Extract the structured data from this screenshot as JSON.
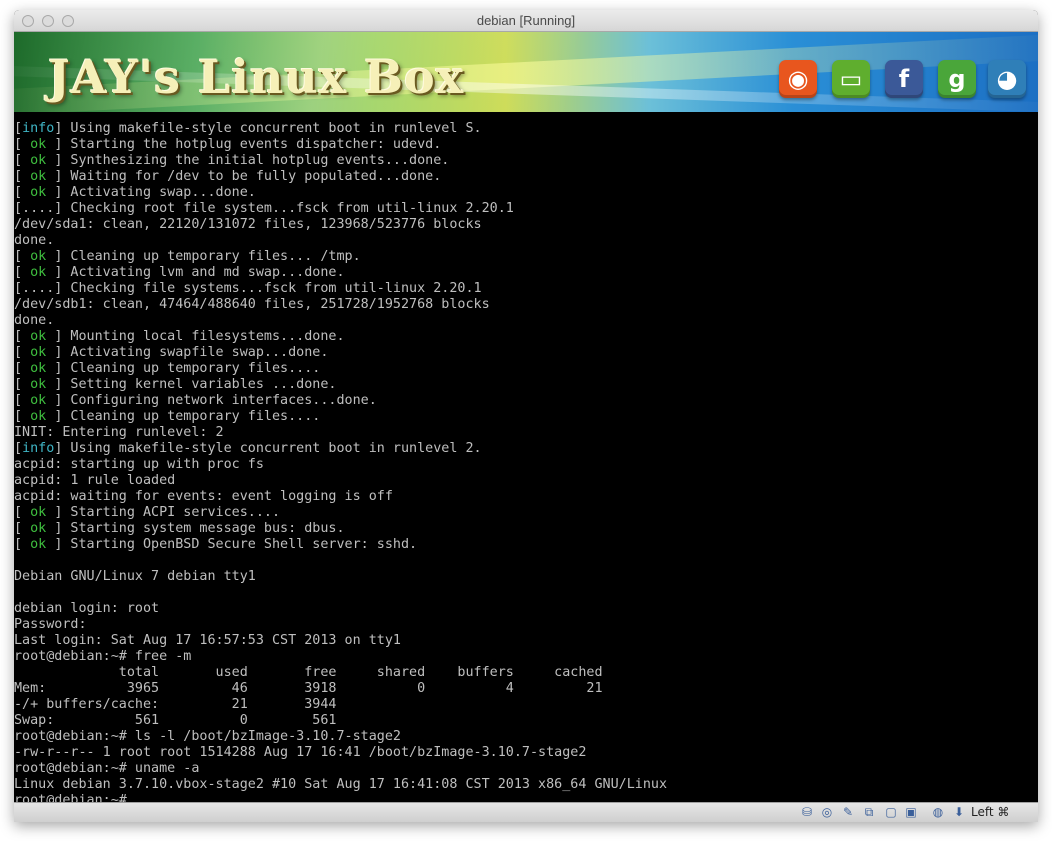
{
  "window": {
    "title": "debian [Running]"
  },
  "banner": {
    "brand": "JAY's Linux Box",
    "icons": [
      {
        "name": "rss-icon",
        "glyph": "◉",
        "color": "#e8561e"
      },
      {
        "name": "chat-icon",
        "glyph": "▭",
        "color": "#5fae2e"
      },
      {
        "name": "facebook-icon",
        "glyph": "f",
        "color": "#3b5998"
      },
      {
        "name": "google-icon",
        "glyph": "g",
        "color": "#4aa63a"
      },
      {
        "name": "penguin-icon",
        "glyph": "◕",
        "color": "#2f7fb8"
      }
    ]
  },
  "terminal": {
    "lines": [
      {
        "tag": "info",
        "text": " Using makefile-style concurrent boot in runlevel S."
      },
      {
        "tag": "ok",
        "text": " Starting the hotplug events dispatcher: udevd."
      },
      {
        "tag": "ok",
        "text": " Synthesizing the initial hotplug events...done."
      },
      {
        "tag": "ok",
        "text": " Waiting for /dev to be fully populated...done."
      },
      {
        "tag": "ok",
        "text": " Activating swap...done."
      },
      {
        "tag": "",
        "text": "[....] Checking root file system...fsck from util-linux 2.20.1"
      },
      {
        "tag": "",
        "text": "/dev/sda1: clean, 22120/131072 files, 123968/523776 blocks"
      },
      {
        "tag": "",
        "text": "done."
      },
      {
        "tag": "ok",
        "text": " Cleaning up temporary files... /tmp."
      },
      {
        "tag": "ok",
        "text": " Activating lvm and md swap...done."
      },
      {
        "tag": "",
        "text": "[....] Checking file systems...fsck from util-linux 2.20.1"
      },
      {
        "tag": "",
        "text": "/dev/sdb1: clean, 47464/488640 files, 251728/1952768 blocks"
      },
      {
        "tag": "",
        "text": "done."
      },
      {
        "tag": "ok",
        "text": " Mounting local filesystems...done."
      },
      {
        "tag": "ok",
        "text": " Activating swapfile swap...done."
      },
      {
        "tag": "ok",
        "text": " Cleaning up temporary files...."
      },
      {
        "tag": "ok",
        "text": " Setting kernel variables ...done."
      },
      {
        "tag": "ok",
        "text": " Configuring network interfaces...done."
      },
      {
        "tag": "ok",
        "text": " Cleaning up temporary files...."
      },
      {
        "tag": "",
        "text": "INIT: Entering runlevel: 2"
      },
      {
        "tag": "info",
        "text": " Using makefile-style concurrent boot in runlevel 2."
      },
      {
        "tag": "",
        "text": "acpid: starting up with proc fs"
      },
      {
        "tag": "",
        "text": "acpid: 1 rule loaded"
      },
      {
        "tag": "",
        "text": "acpid: waiting for events: event logging is off"
      },
      {
        "tag": "ok",
        "text": " Starting ACPI services...."
      },
      {
        "tag": "ok",
        "text": " Starting system message bus: dbus."
      },
      {
        "tag": "ok",
        "text": " Starting OpenBSD Secure Shell server: sshd."
      },
      {
        "tag": "",
        "text": ""
      },
      {
        "tag": "",
        "text": "Debian GNU/Linux 7 debian tty1"
      },
      {
        "tag": "",
        "text": ""
      },
      {
        "tag": "",
        "text": "debian login: root"
      },
      {
        "tag": "",
        "text": "Password:"
      },
      {
        "tag": "",
        "text": "Last login: Sat Aug 17 16:57:53 CST 2013 on tty1"
      },
      {
        "tag": "",
        "text": "root@debian:~# free -m"
      },
      {
        "tag": "",
        "text": "             total       used       free     shared    buffers     cached"
      },
      {
        "tag": "",
        "text": "Mem:          3965         46       3918          0          4         21"
      },
      {
        "tag": "",
        "text": "-/+ buffers/cache:         21       3944"
      },
      {
        "tag": "",
        "text": "Swap:          561          0        561"
      },
      {
        "tag": "",
        "text": "root@debian:~# ls -l /boot/bzImage-3.10.7-stage2"
      },
      {
        "tag": "",
        "text": "-rw-r--r-- 1 root root 1514288 Aug 17 16:41 /boot/bzImage-3.10.7-stage2"
      },
      {
        "tag": "",
        "text": "root@debian:~# uname -a"
      },
      {
        "tag": "",
        "text": "Linux debian 3.7.10.vbox-stage2 #10 Sat Aug 17 16:41:08 CST 2013 x86_64 GNU/Linux"
      },
      {
        "tag": "",
        "text": "root@debian:~# _"
      }
    ]
  },
  "statusbar": {
    "icons": [
      "hard-disk-icon",
      "optical-drive-icon",
      "usb-icon",
      "shared-folders-icon",
      "display-icon",
      "video-capture-icon",
      "network-icon",
      "download-icon"
    ],
    "host_key": "Left ⌘"
  }
}
